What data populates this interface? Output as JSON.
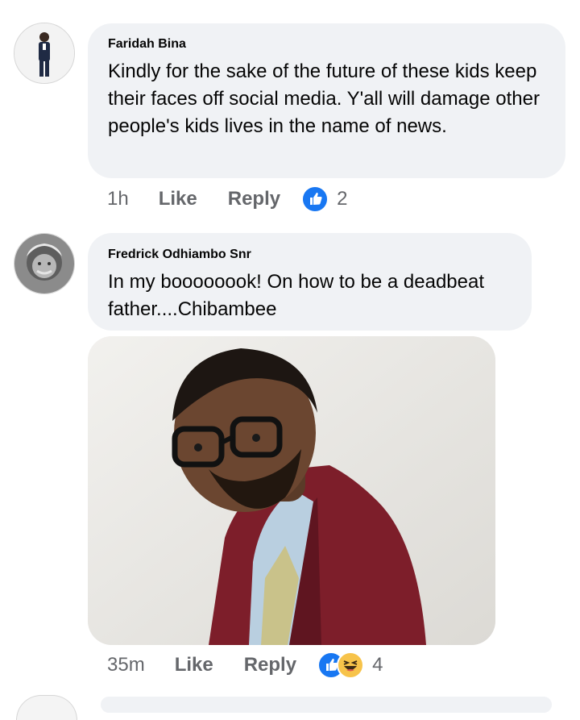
{
  "comments": [
    {
      "author": "Faridah Bina",
      "text": "Kindly for the sake of the future of these kids keep their faces off social media. Y'all will damage other people's kids lives in the name of news.",
      "time": "1h",
      "like_label": "Like",
      "reply_label": "Reply",
      "reactions": [
        "like-icon"
      ],
      "reaction_count": "2"
    },
    {
      "author": "Fredrick Odhiambo Snr",
      "text": "In my boooooook! On how to be a deadbeat father....Chibambee",
      "time": "35m",
      "like_label": "Like",
      "reply_label": "Reply",
      "reactions": [
        "like-icon",
        "haha-icon"
      ],
      "reaction_count": "4",
      "photo_subject": "man with glasses in maroon jacket"
    }
  ],
  "colors": {
    "bubble": "#f0f2f5",
    "meta_text": "#65676b",
    "like_blue": "#1877f2",
    "haha_yellow": "#f7c34a"
  }
}
